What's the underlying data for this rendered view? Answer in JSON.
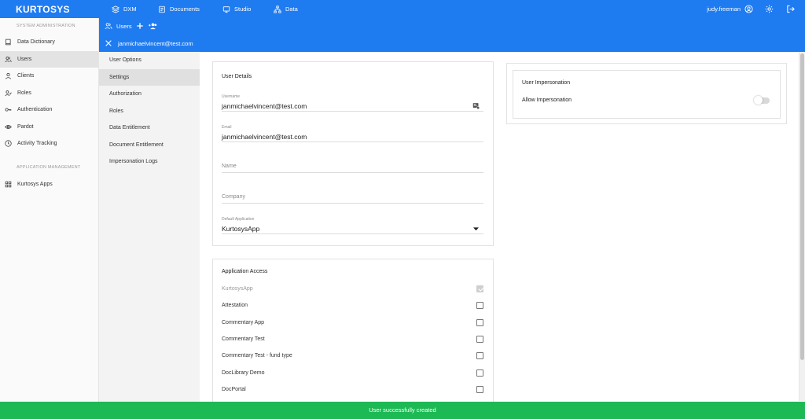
{
  "app": {
    "logo": "KURTOSYS"
  },
  "topnav": [
    {
      "label": "DXM",
      "icon": "layers-icon"
    },
    {
      "label": "Documents",
      "icon": "documents-icon"
    },
    {
      "label": "Studio",
      "icon": "studio-icon"
    },
    {
      "label": "Data",
      "icon": "hierarchy-icon"
    }
  ],
  "user": {
    "name": "judy.freeman"
  },
  "sidebar": {
    "section1": "SYSTEM ADMINISTRATION",
    "items1": [
      {
        "label": "Data Dictionary",
        "icon": "book-icon"
      },
      {
        "label": "Users",
        "icon": "users-icon"
      },
      {
        "label": "Clients",
        "icon": "client-icon"
      },
      {
        "label": "Roles",
        "icon": "roles-icon"
      },
      {
        "label": "Authentication",
        "icon": "key-icon"
      },
      {
        "label": "Pardot",
        "icon": "eye-icon"
      },
      {
        "label": "Activity Tracking",
        "icon": "clock-icon"
      }
    ],
    "section2": "APPLICATION MANAGEMENT",
    "items2": [
      {
        "label": "Kurtosys Apps",
        "icon": "apps-grid-icon"
      }
    ]
  },
  "subheader": {
    "title": "Users",
    "selected_user": "janmichaelvincent@test.com"
  },
  "submenu": [
    "User Options",
    "Settings",
    "Authorization",
    "Roles",
    "Data Entitlement",
    "Document Entitlement",
    "Impersonation Logs"
  ],
  "user_details": {
    "title": "User Details",
    "username_label": "Username",
    "username": "janmichaelvincent@test.com",
    "email_label": "Email",
    "email": "janmichaelvincent@test.com",
    "name_placeholder": "Name",
    "company_placeholder": "Company",
    "default_app_label": "Default Application",
    "default_app": "KurtosysApp"
  },
  "application_access": {
    "title": "Application Access",
    "apps": [
      {
        "label": "KurtosysApp",
        "checked": true,
        "disabled": true
      },
      {
        "label": "Attestation",
        "checked": false
      },
      {
        "label": "Commentary App",
        "checked": false
      },
      {
        "label": "Commentary Test",
        "checked": false
      },
      {
        "label": "Commentary Test - fund type",
        "checked": false
      },
      {
        "label": "DocLibrary Demo",
        "checked": false
      },
      {
        "label": "DocPortal",
        "checked": false
      }
    ]
  },
  "impersonation": {
    "title": "User Impersonation",
    "allow_label": "Allow Impersonation",
    "allowed": false
  },
  "toast": "User successfully created",
  "colors": {
    "primary": "#1f7bf0",
    "success": "#1db954"
  }
}
